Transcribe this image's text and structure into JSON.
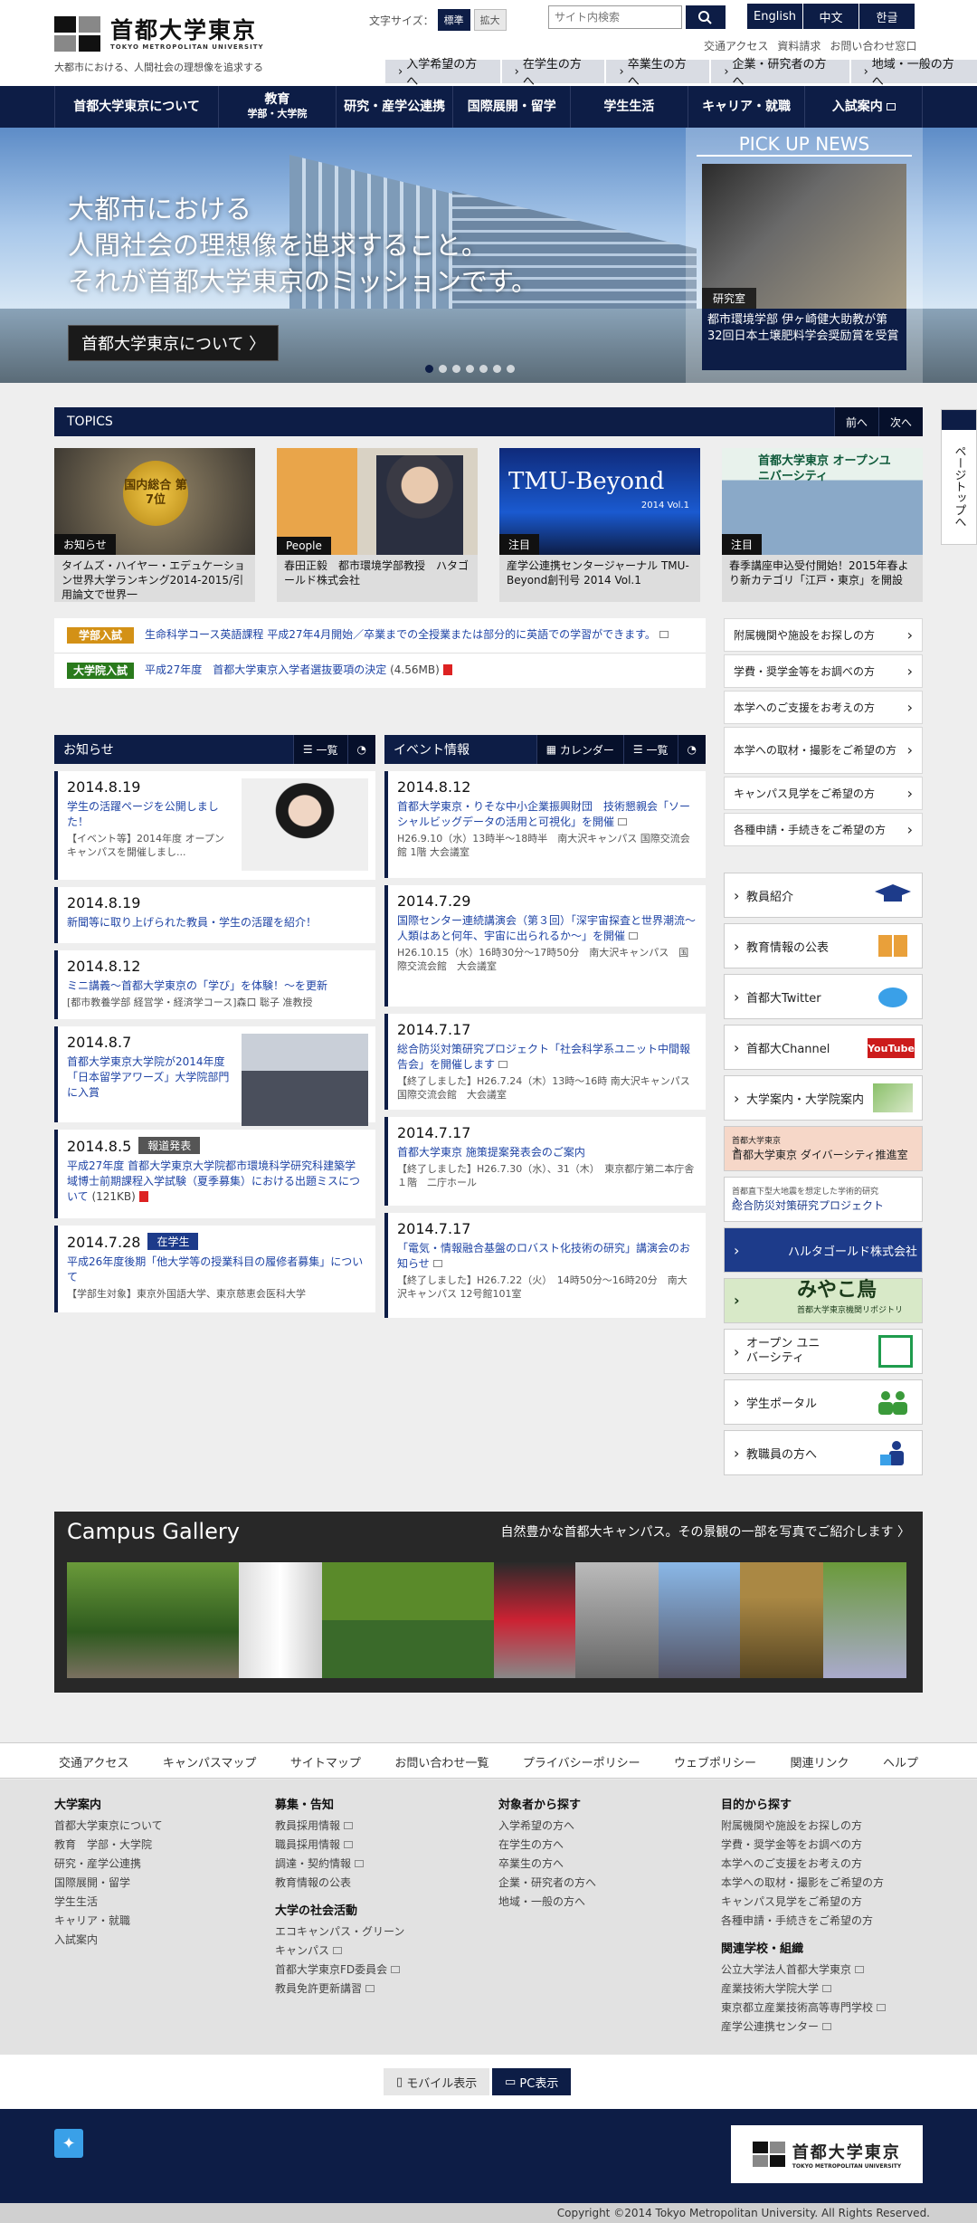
{
  "header": {
    "logo_jp": "首都大学東京",
    "logo_en": "TOKYO METROPOLITAN UNIVERSITY",
    "tagline": "大都市における、人間社会の理想像を追求する",
    "font_size_label": "文字サイズ：",
    "font_std": "標準",
    "font_large": "拡大",
    "search_placeholder": "サイト内検索",
    "langs": [
      "English",
      "中文",
      "한글"
    ],
    "links": [
      "交通アクセス",
      "資料請求",
      "お問い合わせ窓口"
    ],
    "audience": [
      "入学希望の方へ",
      "在学生の方へ",
      "卒業生の方へ",
      "企業・研究者の方へ",
      "地域・一般の方へ"
    ]
  },
  "nav": [
    {
      "label": "首都大学東京について",
      "sub": ""
    },
    {
      "label": "教育",
      "sub": "学部・大学院"
    },
    {
      "label": "研究・産学公連携",
      "sub": ""
    },
    {
      "label": "国際展開・留学",
      "sub": ""
    },
    {
      "label": "学生生活",
      "sub": ""
    },
    {
      "label": "キャリア・就職",
      "sub": ""
    },
    {
      "label": "入試案内",
      "sub": ""
    }
  ],
  "hero": {
    "line1": "大都市における",
    "line2": "人間社会の理想像を追求すること。",
    "line3": "それが首都大学東京のミッションです。",
    "button": "首都大学東京について 〉",
    "pickup_title": "PICK UP NEWS",
    "pickup_tag": "研究室",
    "pickup_text": "都市環境学部 伊ヶ崎健大助教が第32回日本土壌肥料学会奨励賞を受賞"
  },
  "topics": {
    "title": "TOPICS",
    "prev": "前へ",
    "next": "次へ",
    "cards": [
      {
        "tag": "お知らせ",
        "text": "タイムズ・ハイヤー・エデュケーション世界大学ランキング2014-2015/引用論文で世界一",
        "badge": "国内総合 第7位"
      },
      {
        "tag": "People",
        "text": "春田正毅　都市環境学部教授　ハタゴールド株式会社"
      },
      {
        "tag": "注目",
        "text": "産学公連携センタージャーナル TMU-Beyond創刊号 2014 Vol.1",
        "img_title": "TMU-Beyond",
        "img_sub": "2014 Vol.1"
      },
      {
        "tag": "注目",
        "text": "春季講座申込受付開始！2015年春より新カテゴリ「江戸・東京」を開設",
        "img_title": "首都大学東京 オープンユニバーシティ"
      }
    ]
  },
  "announcements": [
    {
      "label": "学部入試",
      "text": "生命科学コース英語課程 平成27年4月開始／卒業までの全授業または部分的に英語での学習ができます。"
    },
    {
      "label": "大学院入試",
      "text": "平成27年度　首都大学東京入学者選抜要項の決定",
      "size": "(4.56MB)"
    }
  ],
  "side_links": [
    "附属機関や施設をお探しの方",
    "学費・奨学金等をお調べの方",
    "本学へのご支援をお考えの方",
    "本学への取材・撮影をご希望の方",
    "キャンパス見学をご希望の方",
    "各種申請・手続きをご希望の方"
  ],
  "banners": [
    "教員紹介",
    "教育情報の公表",
    "首都大Twitter",
    "首都大Channel",
    "大学案内・大学院案内",
    "首都大学東京 ダイバーシティ推進室",
    "総合防災対策研究プロジェクト",
    "ハルタゴールド株式会社",
    "みやこ鳥",
    "オープン ユニバーシティ",
    "学生ポータル",
    "教職員の方へ"
  ],
  "banner_notes": {
    "youtube": "YouTube",
    "disaster_sub": "首都直下型大地震を想定した学術的研究",
    "miyako_sub": "首都大学東京機関リポジトリ",
    "diversity_sub": "首都大学東京"
  },
  "news": {
    "title": "お知らせ",
    "list_label": "一覧",
    "items": [
      {
        "date": "2014.8.19",
        "title": "学生の活躍ページを公開しました！",
        "sub": "【イベント等】2014年度 オープンキャンパスを開催しまし..."
      },
      {
        "date": "2014.8.19",
        "title": "新聞等に取り上げられた教員・学生の活躍を紹介！",
        "sub": ""
      },
      {
        "date": "2014.8.12",
        "title": "ミニ講義〜首都大学東京の「学び」を体験！〜を更新",
        "sub": "[都市教養学部 経営学・経済学コース]森口 聡子 准教授"
      },
      {
        "date": "2014.8.7",
        "title": "首都大学東京大学院が2014年度「日本留学アワーズ」大学院部門に入賞",
        "sub": ""
      },
      {
        "date": "2014.8.5",
        "badge": "報道発表",
        "title": "平成27年度 首都大学東京大学院都市環境科学研究科建築学域博士前期課程入学試験（夏季募集）における出題ミスについて",
        "size": "(121KB)",
        "sub": ""
      },
      {
        "date": "2014.7.28",
        "badge": "在学生",
        "title": "平成26年度後期「他大学等の授業科目の履修者募集」について",
        "sub": "【学部生対象】東京外国語大学、東京慈恵会医科大学"
      }
    ]
  },
  "events": {
    "title": "イベント情報",
    "calendar_label": "カレンダー",
    "list_label": "一覧",
    "items": [
      {
        "date": "2014.8.12",
        "title": "首都大学東京・りそな中小企業振興財団　技術懇親会「ソーシャルビッグデータの活用と可視化」を開催",
        "sub": "H26.9.10（水）13時半〜18時半　南大沢キャンパス 国際交流会館 1階 大会議室"
      },
      {
        "date": "2014.7.29",
        "title": "国際センター連続講演会（第３回）「深宇宙探査と世界潮流〜人類はあと何年、宇宙に出られるか〜」を開催",
        "sub": "H26.10.15（水）16時30分〜17時50分　南大沢キャンパス　国際交流会館　大会議室"
      },
      {
        "date": "2014.7.17",
        "title": "総合防災対策研究プロジェクト「社会科学系ユニット中間報告会」を開催します",
        "sub": "【終了しました】H26.7.24（木）13時〜16時 南大沢キャンパス　国際交流会館　大会議室"
      },
      {
        "date": "2014.7.17",
        "title": "首都大学東京 施策提案発表会のご案内",
        "sub": "【終了しました】H26.7.30（水）、31（木）　東京都庁第二本庁舎１階　二庁ホール"
      },
      {
        "date": "2014.7.17",
        "title": "「電気・情報融合基盤のロバスト化技術の研究」講演会のお知らせ",
        "sub": "【終了しました】H26.7.22（火）　14時50分〜16時20分　南大沢キャンパス 12号館101室"
      }
    ]
  },
  "gallery": {
    "title": "Campus Gallery",
    "subtitle": "自然豊かな首都大キャンパス。その景観の一部を写真でご紹介します 〉"
  },
  "footer": {
    "bar": [
      "交通アクセス",
      "キャンパスマップ",
      "サイトマップ",
      "お問い合わせ一覧",
      "プライバシーポリシー",
      "ウェブポリシー",
      "関連リンク",
      "ヘルプ"
    ],
    "col1": {
      "title": "大学案内",
      "items": [
        "首都大学東京について",
        "教育　学部・大学院",
        "研究・産学公連携",
        "国際展開・留学",
        "学生生活",
        "キャリア・就職",
        "入試案内"
      ]
    },
    "col2": {
      "title": "募集・告知",
      "items": [
        "教員採用情報",
        "職員採用情報",
        "調達・契約情報",
        "教育情報の公表"
      ],
      "title2": "大学の社会活動",
      "items2": [
        "エコキャンパス・グリーン",
        "キャンパス",
        "首都大学東京FD委員会",
        "教員免許更新講習"
      ]
    },
    "col3": {
      "title": "対象者から探す",
      "items": [
        "入学希望の方へ",
        "在学生の方へ",
        "卒業生の方へ",
        "企業・研究者の方へ",
        "地域・一般の方へ"
      ]
    },
    "col4": {
      "title": "目的から探す",
      "items": [
        "附属機関や施設をお探しの方",
        "学費・奨学金等をお調べの方",
        "本学へのご支援をお考えの方",
        "本学への取材・撮影をご希望の方",
        "キャンパス見学をご希望の方",
        "各種申請・手続きをご希望の方"
      ],
      "title2": "関連学校・組織",
      "items2": [
        "公立大学法人首都大学東京",
        "産業技術大学院大学",
        "東京都立産業技術高等専門学校",
        "産学公連携センター"
      ]
    },
    "mobile": "モバイル表示",
    "pc": "PC表示",
    "copyright": "Copyright ©2014 Tokyo Metropolitan University. All Rights Reserved.",
    "page_top": "ページトップへ"
  },
  "colors": {
    "navy": "#0d1d46",
    "gakubu": "#d39116",
    "daigakuin": "#2a7a1c",
    "houdou": "#555555",
    "zaigaku": "#1d3b8a"
  }
}
